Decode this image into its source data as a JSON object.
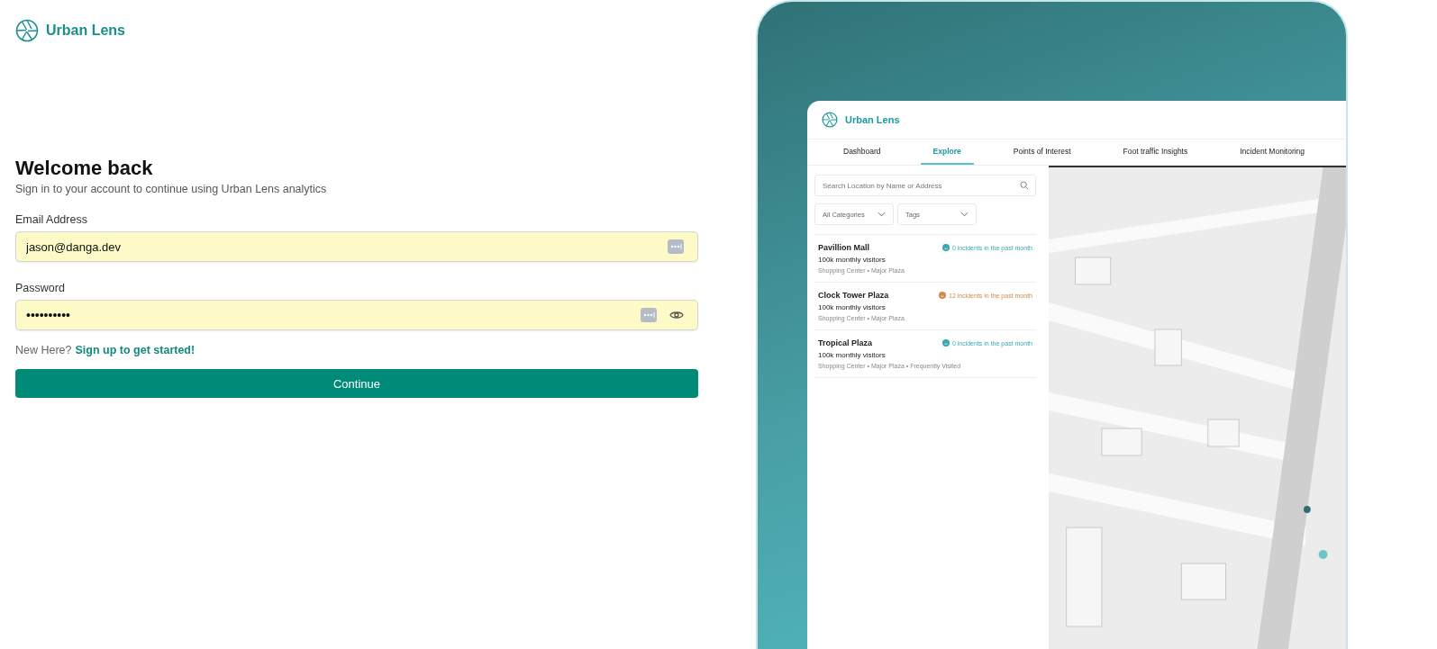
{
  "brand": {
    "name": "Urban Lens"
  },
  "login": {
    "title": "Welcome back",
    "subtitle": "Sign in to your account to continue using Urban Lens analytics",
    "fields": [
      {
        "label": "Email Address",
        "value": "jason@danga.dev",
        "kind": "text",
        "autofilled": true
      },
      {
        "label": "Password",
        "value": "••••••••••",
        "kind": "password",
        "autofilled": true
      }
    ],
    "signup_prompt": "New Here?",
    "signup_link": "Sign up to get started!",
    "submit": "Continue"
  },
  "preview": {
    "brand": "Urban Lens",
    "tabs": [
      {
        "label": "Dashboard",
        "selected": false
      },
      {
        "label": "Explore",
        "selected": true
      },
      {
        "label": "Points of Interest",
        "selected": false
      },
      {
        "label": "Foot traffic Insights",
        "selected": false
      },
      {
        "label": "Incident Monitoring",
        "selected": false
      }
    ],
    "search": {
      "placeholder": "Search Location by Name or Address"
    },
    "filters": [
      "All Categories",
      "Tags"
    ],
    "places": [
      {
        "name": "Pavillion Mall",
        "visitors": "100k monthly visitors",
        "tags": "Shopping Center • Major Plaza",
        "incidents": "0 incidents in the past month",
        "color": "#3aa8b0"
      },
      {
        "name": "Clock Tower Plaza",
        "visitors": "100k monthly visitors",
        "tags": "Shopping Center • Major Plaza",
        "incidents": "12 incidents in the past month",
        "color": "#d08a4a"
      },
      {
        "name": "Tropical Plaza",
        "visitors": "100k monthly visitors",
        "tags": "Shopping Center • Major Plaza  •  Frequently Visited",
        "incidents": "0 incidents in the past month",
        "color": "#3aa8b0"
      }
    ],
    "map": {
      "kind": "picture"
    }
  }
}
